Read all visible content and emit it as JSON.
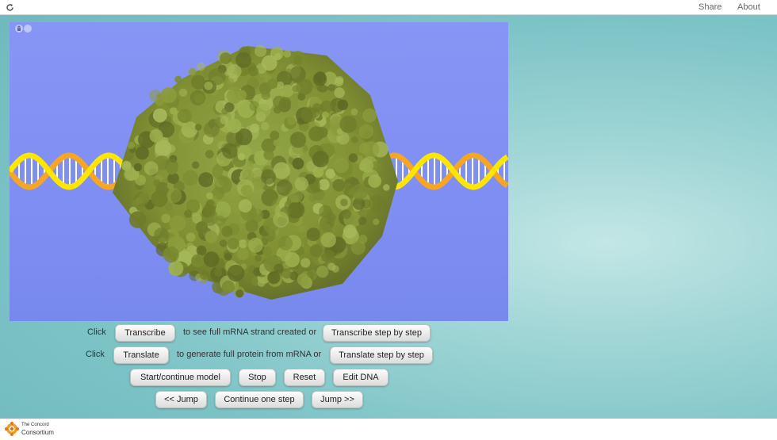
{
  "topbar": {
    "reload_icon": "reload-icon",
    "share_label": "Share",
    "about_label": "About"
  },
  "model": {
    "info_icon": "i",
    "lock_icon": "lock-icon",
    "colors": {
      "background": "#8090f2",
      "dna_yellow": "#ffe600",
      "dna_orange": "#f7a623",
      "polymerase": "#8a9a3a"
    }
  },
  "controls": {
    "row1": {
      "click_label": "Click",
      "transcribe_button": "Transcribe",
      "middle_text": "to see full mRNA strand created or",
      "transcribe_step_button": "Transcribe step by step"
    },
    "row2": {
      "click_label": "Click",
      "translate_button": "Translate",
      "middle_text": "to generate full protein from mRNA or",
      "translate_step_button": "Translate step by step"
    },
    "row3": {
      "start_button": "Start/continue model",
      "stop_button": "Stop",
      "reset_button": "Reset",
      "edit_dna_button": "Edit DNA"
    },
    "row4": {
      "jump_back_button": "<< Jump",
      "continue_step_button": "Continue one step",
      "jump_forward_button": "Jump >>"
    }
  },
  "footer": {
    "logo_small": "The Concord",
    "logo_large": "Consortium"
  }
}
